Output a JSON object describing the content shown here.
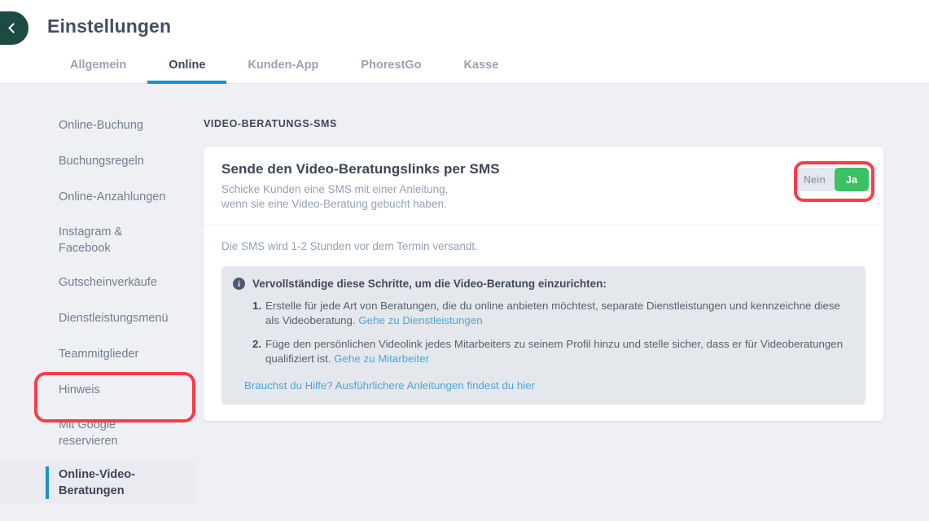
{
  "header": {
    "title": "Einstellungen",
    "back_icon": "chevron-left-icon",
    "back_color": "#1d4a42"
  },
  "tabs": [
    {
      "label": "Allgemein",
      "active": false
    },
    {
      "label": "Online",
      "active": true
    },
    {
      "label": "Kunden-App",
      "active": false
    },
    {
      "label": "PhorestGo",
      "active": false
    },
    {
      "label": "Kasse",
      "active": false
    }
  ],
  "sidebar": {
    "items": [
      {
        "label": "Online-Buchung",
        "active": false
      },
      {
        "label": "Buchungsregeln",
        "active": false
      },
      {
        "label": "Online-Anzahlungen",
        "active": false
      },
      {
        "label": "Instagram & Facebook",
        "active": false
      },
      {
        "label": "Gutscheinverkäufe",
        "active": false
      },
      {
        "label": "Dienstleistungsmenü",
        "active": false
      },
      {
        "label": "Teammitglieder",
        "active": false
      },
      {
        "label": "Hinweis",
        "active": false
      },
      {
        "label": "Mit Google reservieren",
        "active": false
      },
      {
        "label": "Online-Video-Beratungen",
        "active": true
      }
    ]
  },
  "main": {
    "section_title": "VIDEO-BERATUNGS-SMS",
    "card": {
      "title": "Sende den Video-Beratungslinks per SMS",
      "subtitle_line1": "Schicke Kunden eine SMS mit einer Anleitung,",
      "subtitle_line2": "wenn sie eine Video-Beratung gebucht haben.",
      "toggle": {
        "off_label": "Nein",
        "on_label": "Ja",
        "selected": "Ja",
        "on_color": "#3ac162",
        "off_color": "#e4e7ec"
      },
      "note": "Die SMS wird 1-2 Stunden vor dem Termin versandt.",
      "info_box": {
        "icon": "info-icon",
        "heading": "Vervollständige diese Schritte, um die Video-Beratung einzurichten:",
        "steps": [
          {
            "number": "1.",
            "text": "Erstelle für jede Art von Beratungen, die du online anbieten möchtest, separate Dienstleistungen und kennzeichne diese als Videoberatung. ",
            "link": "Gehe zu Dienstleistungen"
          },
          {
            "number": "2.",
            "text": "Füge den persönlichen Videolink jedes Mitarbeiters zu seinem Profil hinzu und stelle sicher, dass er für Videoberatungen qualifiziert ist. ",
            "link": "Gehe zu Mitarbeiter"
          }
        ],
        "help_link": "Brauchst du Hilfe? Ausführlichere Anleitungen findest du hier"
      }
    }
  },
  "annotations": {
    "ring_color": "#fa3b4a",
    "sidebar_ring_target": "Online-Video-Beratungen",
    "toggle_ring_target": "Ja/Nein toggle"
  }
}
